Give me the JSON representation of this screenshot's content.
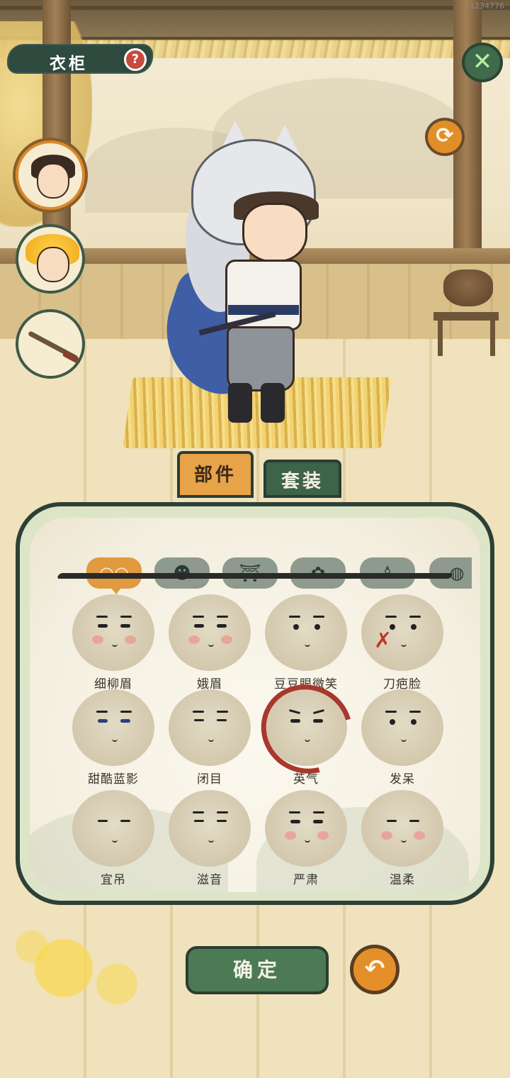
{
  "status_bar": {
    "build_id": "1234776"
  },
  "header": {
    "title": "衣柜",
    "help_icon_glyph": "?",
    "close_icon": "close-icon",
    "close_glyph": "✕",
    "rotate_icon": "rotate-icon",
    "rotate_glyph": "⟳"
  },
  "avatar_slots": [
    {
      "name": "dark-haired-character",
      "active": true
    },
    {
      "name": "golden-haired-character",
      "active": false
    },
    {
      "name": "sword-weapon",
      "active": false
    }
  ],
  "tabs": [
    {
      "label": "部件",
      "active": true
    },
    {
      "label": "套装",
      "active": false
    }
  ],
  "categories": [
    {
      "icon": "face-icon",
      "glyph": "◠◠",
      "active": true
    },
    {
      "icon": "hair-icon",
      "glyph": "☻",
      "active": false
    },
    {
      "icon": "clothing-icon",
      "glyph": "⛩",
      "active": false
    },
    {
      "icon": "flower-icon",
      "glyph": "✿",
      "active": false
    },
    {
      "icon": "pants-icon",
      "glyph": "♙",
      "active": false
    },
    {
      "icon": "more-icon",
      "glyph": "◍",
      "active": false
    }
  ],
  "faces": [
    {
      "label": "细柳眉",
      "selected": false
    },
    {
      "label": "娥眉",
      "selected": false
    },
    {
      "label": "豆豆眼微笑",
      "selected": false
    },
    {
      "label": "刀疤脸",
      "selected": false
    },
    {
      "label": "甜酷蓝影",
      "selected": false
    },
    {
      "label": "闭目",
      "selected": false
    },
    {
      "label": "英气",
      "selected": true
    },
    {
      "label": "发呆",
      "selected": false
    },
    {
      "label": "宜吊",
      "selected": false
    },
    {
      "label": "滋音",
      "selected": false
    },
    {
      "label": "严肃",
      "selected": false
    },
    {
      "label": "温柔",
      "selected": false
    }
  ],
  "footer": {
    "confirm_label": "确定",
    "reset_icon": "undo-icon",
    "reset_glyph": "↶"
  },
  "colors": {
    "accent_orange": "#e19a3e",
    "panel_green": "#2d4035",
    "confirm_green": "#4c7a55",
    "selection_red": "#a8382c"
  }
}
